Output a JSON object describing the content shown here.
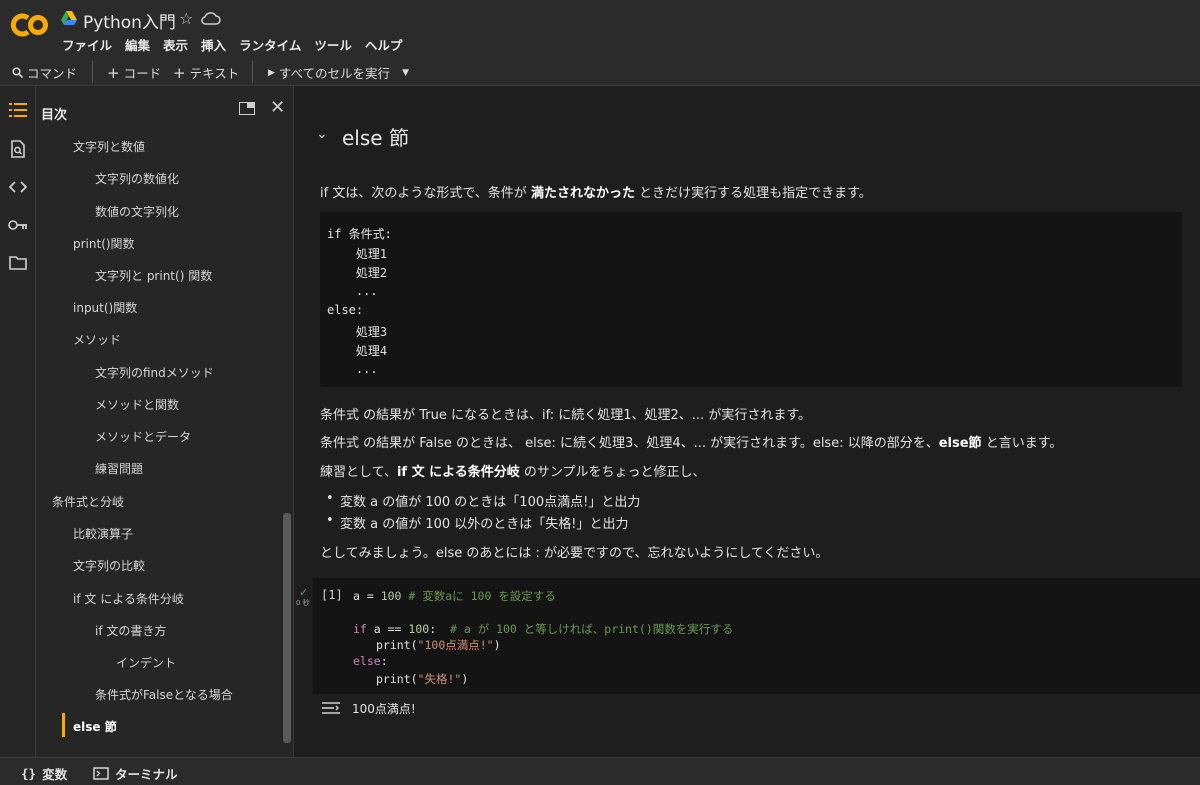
{
  "colors": {
    "accent": "#f9ab00",
    "logo_orange": "#f9ab00",
    "logo_dark": "#e37400"
  },
  "header": {
    "title": "Python入門",
    "logo_text": "CO",
    "menu": [
      "ファイル",
      "編集",
      "表示",
      "挿入",
      "ランタイム",
      "ツール",
      "ヘルプ"
    ]
  },
  "toolbar": {
    "command": "コマンド",
    "code": "コード",
    "text": "テキスト",
    "run_all": "すべてのセルを実行"
  },
  "rail": {
    "icons": [
      "toc-icon",
      "find-icon",
      "code-snippets-icon",
      "secrets-icon",
      "files-icon"
    ]
  },
  "toc": {
    "title": "目次",
    "items": [
      "文字列と数値",
      "文字列の数値化",
      "数値の文字列化",
      "print()関数",
      "文字列と print() 関数",
      "input()関数",
      "メソッド",
      "文字列のfindメソッド",
      "メソッドと関数",
      "メソッドとデータ",
      "練習問題",
      "条件式と分岐",
      "比較演算子",
      "文字列の比較",
      "if 文 による条件分岐",
      "if 文の書き方",
      "インデント",
      "条件式がFalseとなる場合",
      "else 節"
    ]
  },
  "main": {
    "heading": "else 節",
    "p1": {
      "a": "if 文は、次のような形式で、条件が ",
      "b": "満たされなかった",
      "c": " ときだけ実行する処理も指定できます。"
    },
    "syntax": [
      "if 条件式:",
      "    処理1",
      "    処理2",
      "    ...",
      "else:",
      "    処理3",
      "    処理4",
      "    ..."
    ],
    "p2": "条件式 の結果が True になるときは、if: に続く処理1、処理2、... が実行されます。",
    "p3": {
      "a": "条件式 の結果が False のときは、 else: に続く処理3、処理4、... が実行されます。else: 以降の部分を、",
      "b": "else節",
      "c": " と言います。"
    },
    "p4": {
      "a": "練習として、",
      "b": "if 文 による条件分岐",
      "c": " のサンプルをちょっと修正し、"
    },
    "bullets": [
      "変数 a の値が 100 のときは「100点満点!」と出力",
      "変数 a の値が 100 以外のときは「失格!」と出力"
    ],
    "p5": "としてみましょう。else のあとには : が必要ですので、忘れないようにしてください。",
    "cell": {
      "exec_count": "[1]",
      "time": "0 秒",
      "line1_code": "a = ",
      "line1_num": "100",
      "line1_comment": " # 変数aに 100 を設定する",
      "line3_kw": "if",
      "line3_code": " a == ",
      "line3_num": "100",
      "line3_colon": ":  ",
      "line3_comment": "# a が 100 と等しければ、print()関数を実行する",
      "line4_fn": "print(",
      "line4_str": "\"100点満点!\"",
      "line4_end": ")",
      "line5_kw": "else",
      "line5_colon": ":",
      "line6_fn": "print(",
      "line6_str": "\"失格!\"",
      "line6_end": ")"
    },
    "output": "100点満点!"
  },
  "statusbar": {
    "variables": "変数",
    "terminal": "ターミナル"
  }
}
